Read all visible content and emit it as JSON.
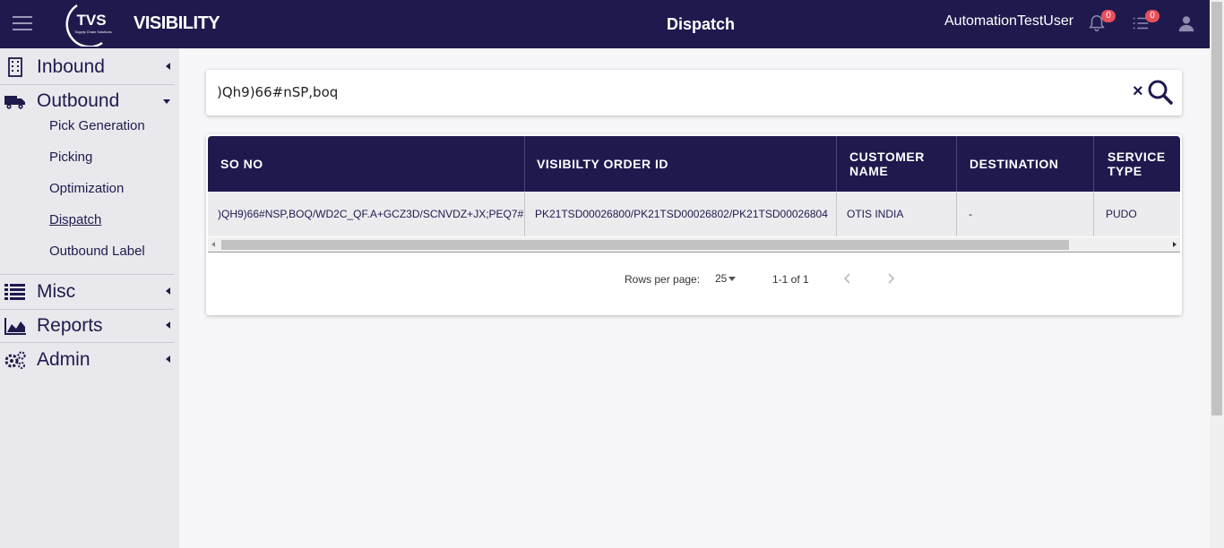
{
  "header": {
    "brand": "VISIBILITY",
    "logo_text": "TVS",
    "logo_subtext": "Supply Chain Solutions",
    "page_title": "Dispatch",
    "username": "AutomationTestUser",
    "notifications_count": "0",
    "tasks_count": "0"
  },
  "sidebar": {
    "inbound": "Inbound",
    "outbound": "Outbound",
    "outbound_items": [
      "Pick Generation",
      "Picking",
      "Optimization",
      "Dispatch",
      "Outbound Label"
    ],
    "misc": "Misc",
    "reports": "Reports",
    "admin": "Admin"
  },
  "search": {
    "value": ")Qh9)66#nSP,boq"
  },
  "table": {
    "columns": [
      "SO NO",
      "VISIBILTY ORDER ID",
      "CUSTOMER NAME",
      "DESTINATION",
      "SERVICE TYPE"
    ],
    "rows": [
      [
        ")QH9)66#NSP,BOQ/WD2C_QF.A+GCZ3D/SCNVDZ+JX;PEQ7#",
        "PK21TSD00026800/PK21TSD00026802/PK21TSD00026804",
        "OTIS INDIA",
        "-",
        "PUDO"
      ]
    ]
  },
  "pagination": {
    "rows_per_page_label": "Rows per page:",
    "rows_per_page": "25",
    "range": "1-1 of 1"
  },
  "colors": {
    "primary": "#1e1a4e",
    "badge": "#e8505b",
    "background": "#f7f7f9"
  }
}
